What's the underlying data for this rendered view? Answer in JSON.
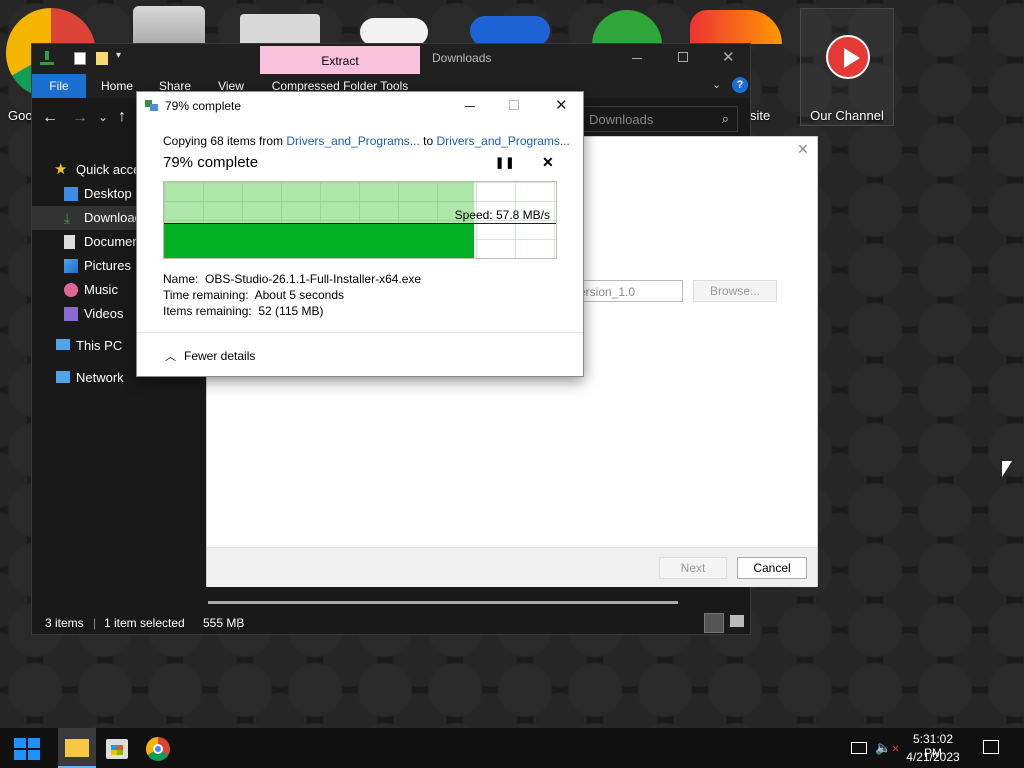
{
  "desktop": {
    "icons": [
      {
        "name": "google-chrome",
        "label": "Goo"
      },
      {
        "name": "recycle-bin",
        "label": ""
      },
      {
        "name": "folder",
        "label": ""
      },
      {
        "name": "xbox-controller",
        "label": ""
      },
      {
        "name": "ps-controller",
        "label": ""
      },
      {
        "name": "xbox-app",
        "label": ""
      },
      {
        "name": "website-app",
        "label": "site"
      },
      {
        "name": "our-channel",
        "label": "Our Channel"
      }
    ]
  },
  "explorer": {
    "title": "Downloads",
    "contextual_tab": "Extract",
    "ribbon_tabs": [
      "File",
      "Home",
      "Share",
      "View",
      "Compressed Folder Tools"
    ],
    "search_placeholder": "Search Downloads",
    "search_partial": "Downloads",
    "nav_items": [
      {
        "label": "Quick access",
        "icon": "star-icon"
      },
      {
        "label": "Desktop",
        "icon": "desktop-icon"
      },
      {
        "label": "Downloads",
        "icon": "download-icon"
      },
      {
        "label": "Documents",
        "icon": "documents-icon"
      },
      {
        "label": "Pictures",
        "icon": "pictures-icon"
      },
      {
        "label": "Music",
        "icon": "music-icon"
      },
      {
        "label": "Videos",
        "icon": "videos-icon"
      },
      {
        "label": "This PC",
        "icon": "pc-icon"
      },
      {
        "label": "Network",
        "icon": "network-icon"
      }
    ],
    "status": {
      "items": "3 items",
      "selected": "1 item selected",
      "size": "555 MB"
    }
  },
  "wizard": {
    "path_value": "ersion_1.0",
    "browse_label": "Browse...",
    "next_label": "Next",
    "cancel_label": "Cancel"
  },
  "copy_dialog": {
    "title": "79% complete",
    "copying_prefix": "Copying 68 items from",
    "source": "Drivers_and_Programs...",
    "to": "to",
    "dest": "Drivers_and_Programs...",
    "heading": "79% complete",
    "progress_percent": 79,
    "speed": "Speed: 57.8 MB/s",
    "name_label": "Name:",
    "name_value": "OBS-Studio-26.1.1-Full-Installer-x64.exe",
    "time_label": "Time remaining:",
    "time_value": "About 5 seconds",
    "items_label": "Items remaining:",
    "items_value": "52 (115 MB)",
    "fewer_details": "Fewer details"
  },
  "taskbar": {
    "time": "5:31:02 PM",
    "date": "4/21/2023"
  },
  "colors": {
    "accent": "#0078d7",
    "progress_light": "#a6e3a0",
    "progress_dark": "#06b025",
    "contextual_tab": "#f9c1dc"
  }
}
